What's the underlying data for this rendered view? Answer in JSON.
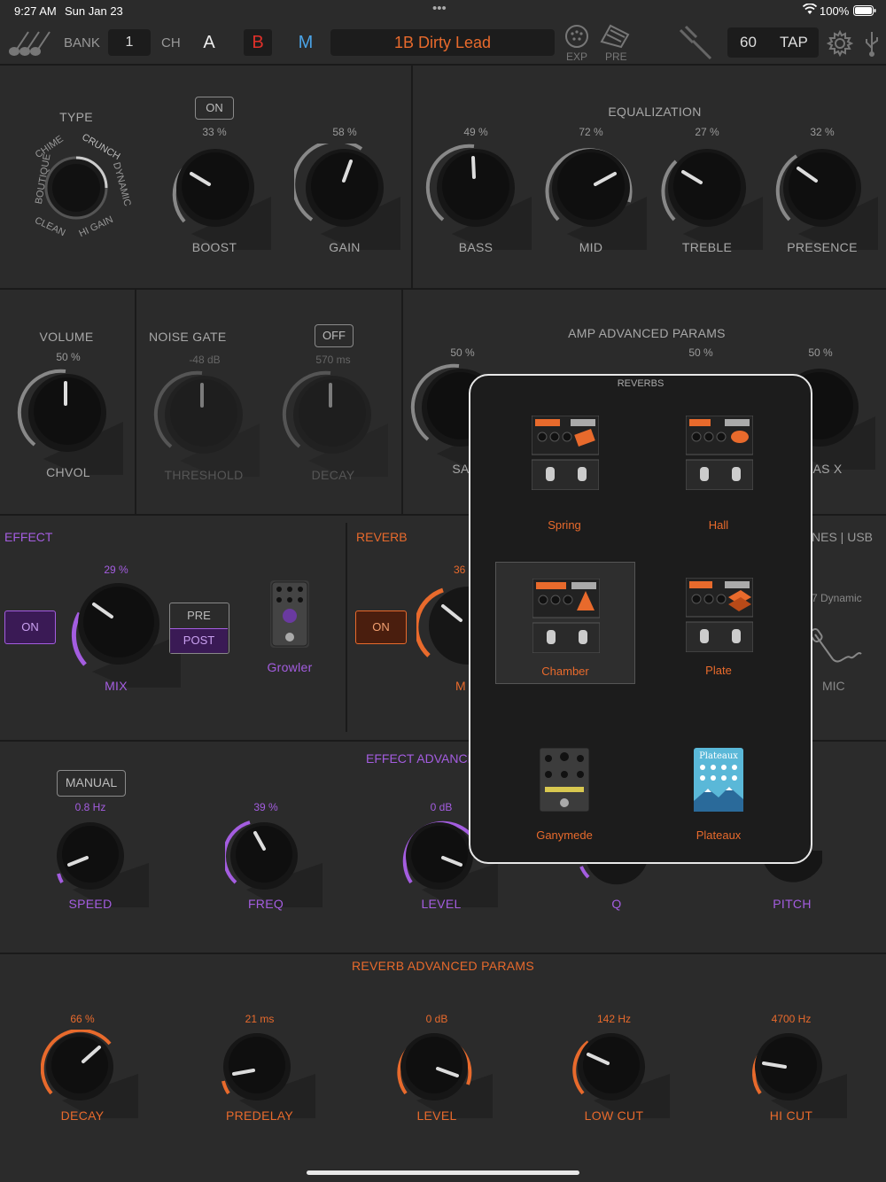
{
  "status": {
    "time": "9:27 AM",
    "date": "Sun Jan 23",
    "dots": "•••",
    "battery": "100%"
  },
  "topbar": {
    "bank_label": "BANK",
    "bank_value": "1",
    "ch_label": "CH",
    "ch_a": "A",
    "ch_b": "B",
    "ch_m": "M",
    "preset_name": "1B Dirty Lead",
    "exp_label": "EXP",
    "pre_label": "PRE",
    "tempo": "60",
    "tap_label": "TAP"
  },
  "amp": {
    "type_label": "TYPE",
    "types": [
      "BOUTIQUE",
      "CHIME",
      "CRUNCH",
      "DYNAMIC",
      "HI GAIN",
      "CLEAN"
    ],
    "boost_toggle": "ON",
    "knobs": [
      {
        "label": "BOOST",
        "value": "33 %"
      },
      {
        "label": "GAIN",
        "value": "58 %"
      }
    ]
  },
  "eq": {
    "title": "EQUALIZATION",
    "knobs": [
      {
        "label": "BASS",
        "value": "49 %"
      },
      {
        "label": "MID",
        "value": "72 %"
      },
      {
        "label": "TREBLE",
        "value": "27 %"
      },
      {
        "label": "PRESENCE",
        "value": "32 %"
      }
    ]
  },
  "volume": {
    "title": "VOLUME",
    "value": "50 %",
    "label": "CHVOL"
  },
  "noise_gate": {
    "title": "NOISE GATE",
    "toggle": "OFF",
    "threshold": {
      "label": "THRESHOLD",
      "value": "-48 dB"
    },
    "decay": {
      "label": "DECAY",
      "value": "570 ms"
    }
  },
  "amp_adv": {
    "title": "AMP ADVANCED PARAMS",
    "values": [
      "50 %",
      "50 %",
      "50 %"
    ],
    "labels": [
      "SA",
      "AS X"
    ]
  },
  "effect": {
    "title": "EFFECT",
    "on_label": "ON",
    "mix_value": "29 %",
    "mix_label": "MIX",
    "pre_label": "PRE",
    "post_label": "POST",
    "pedal_name": "Growler"
  },
  "reverb": {
    "title": "REVERB",
    "on_label": "ON",
    "value": "36",
    "knob_label": "M"
  },
  "right_partial": {
    "header": "NES | USB",
    "dynamic": "7 Dynamic",
    "mic": "MIC"
  },
  "effect_adv": {
    "title": "EFFECT ADVANCE",
    "manual_label": "MANUAL",
    "knobs": [
      {
        "label": "SPEED",
        "value": "0.8 Hz"
      },
      {
        "label": "FREQ",
        "value": "39 %"
      },
      {
        "label": "LEVEL",
        "value": "0 dB"
      },
      {
        "label": "Q",
        "value": ""
      },
      {
        "label": "PITCH",
        "value": ""
      }
    ]
  },
  "reverb_adv": {
    "title": "REVERB ADVANCED PARAMS",
    "knobs": [
      {
        "label": "DECAY",
        "value": "66 %"
      },
      {
        "label": "PREDELAY",
        "value": "21 ms"
      },
      {
        "label": "LEVEL",
        "value": "0 dB"
      },
      {
        "label": "LOW CUT",
        "value": "142 Hz"
      },
      {
        "label": "HI CUT",
        "value": "4700 Hz"
      }
    ]
  },
  "popup": {
    "title": "REVERBS",
    "items": [
      {
        "name": "Spring",
        "tag": "SPRING"
      },
      {
        "name": "Hall",
        "tag": "HALL"
      },
      {
        "name": "Chamber",
        "tag": "CHAMBER"
      },
      {
        "name": "Plate",
        "tag": "PLATE"
      },
      {
        "name": "Ganymede",
        "tag": "GANYMEDE"
      },
      {
        "name": "Plateaux",
        "tag": "Plateaux"
      }
    ],
    "selected": "Chamber"
  },
  "colors": {
    "accent_orange": "#e86a2c",
    "accent_purple": "#a45de0",
    "accent_blue": "#4aa3e6",
    "accent_red": "#e0302a"
  }
}
